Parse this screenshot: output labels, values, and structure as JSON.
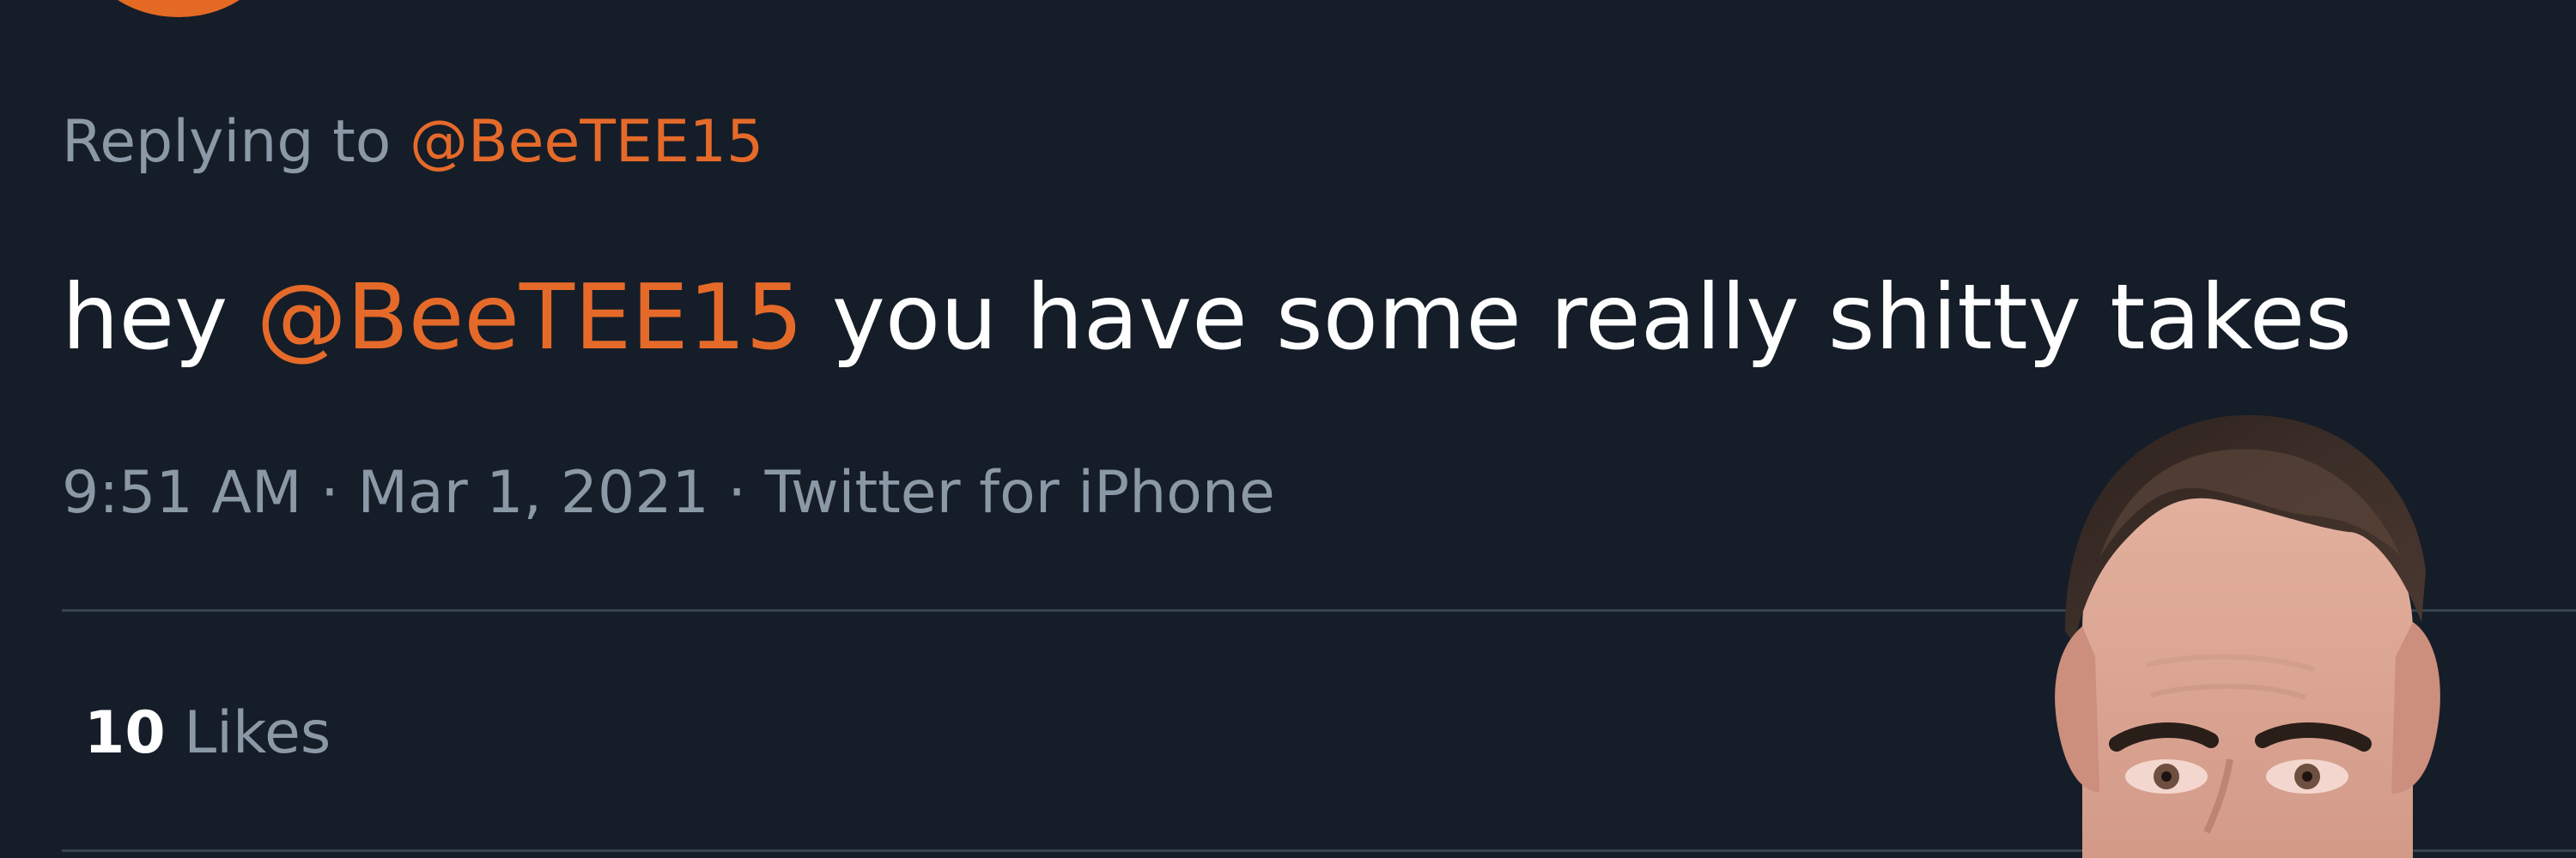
{
  "tweet": {
    "replying_prefix": "Replying to",
    "replying_handle": "@BeeTEE15",
    "text_prefix": "hey",
    "text_mention": "@BeeTEE15",
    "text_suffix": "you have some really shitty takes",
    "timestamp": "9:51 AM · Mar 1, 2021 · Twitter for iPhone",
    "likes_count": "10",
    "likes_label": "Likes"
  },
  "colors": {
    "background": "#151d28",
    "muted_text": "#8b98a5",
    "mention": "#e56a2a",
    "primary_text": "#ffffff",
    "divider": "#38444d",
    "avatar_accent": "#e46a24"
  },
  "icons": {
    "avatar": "profile-avatar",
    "portrait": "hockey-player-portrait"
  }
}
